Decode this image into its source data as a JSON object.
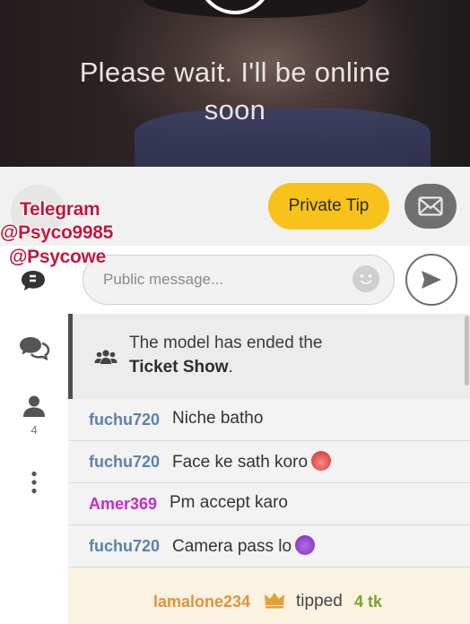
{
  "video": {
    "status_text_line1": "Please wait. I'll be online",
    "status_text_line2": "soon"
  },
  "watermark": {
    "line1": "Telegram",
    "line2": "@Psyco9985",
    "line3": "@Psycowe"
  },
  "actions": {
    "private_tip_label": "Private Tip"
  },
  "composer": {
    "placeholder": "Public message..."
  },
  "sidebar": {
    "user_count": "4"
  },
  "notice": {
    "line1": "The model has ended the",
    "line2_bold": "Ticket Show",
    "line2_suffix": "."
  },
  "messages": [
    {
      "user": "fuchu720",
      "text": "Niche batho",
      "user_color": "#5c82ad"
    },
    {
      "user": "fuchu720",
      "text": "Face ke sath koro",
      "user_color": "#5c82ad",
      "emoji": "hot-face-emoji"
    },
    {
      "user": "Amer369",
      "text": "Pm accept karo",
      "user_color": "#c62ac9"
    },
    {
      "user": "fuchu720",
      "text": "Camera pass lo",
      "user_color": "#5c82ad",
      "emoji": "smiling-devil-emoji"
    }
  ],
  "tip_event": {
    "user": "lamalone234",
    "action": "tipped",
    "amount": "4 tk"
  },
  "colors": {
    "accent_yellow": "#f8c21b",
    "tip_background": "#faf3e1",
    "watermark_red": "#c0183e"
  }
}
